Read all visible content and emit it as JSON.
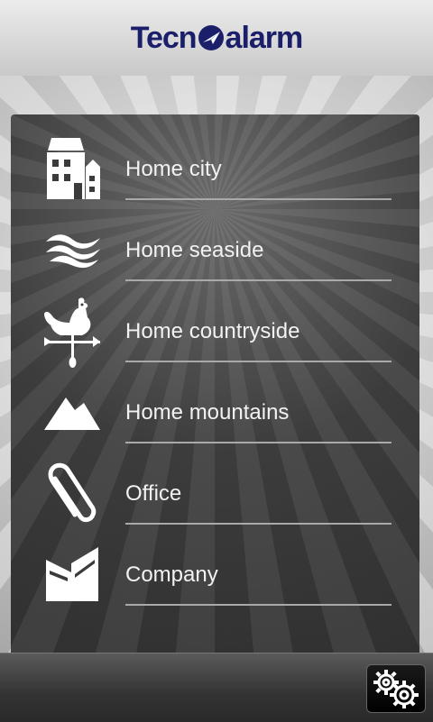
{
  "header": {
    "logo_text_left": "Tecn",
    "logo_text_right": "alarm",
    "brand_color": "#1b1f6a"
  },
  "sites": [
    {
      "label": "Home city",
      "icon": "building-icon"
    },
    {
      "label": "Home seaside",
      "icon": "waves-icon"
    },
    {
      "label": "Home countryside",
      "icon": "rooster-weathervane-icon"
    },
    {
      "label": "Home mountains",
      "icon": "mountains-icon"
    },
    {
      "label": "Office",
      "icon": "paperclip-icon"
    },
    {
      "label": "Company",
      "icon": "factory-icon"
    }
  ],
  "footer": {
    "settings_icon": "gears-icon"
  }
}
